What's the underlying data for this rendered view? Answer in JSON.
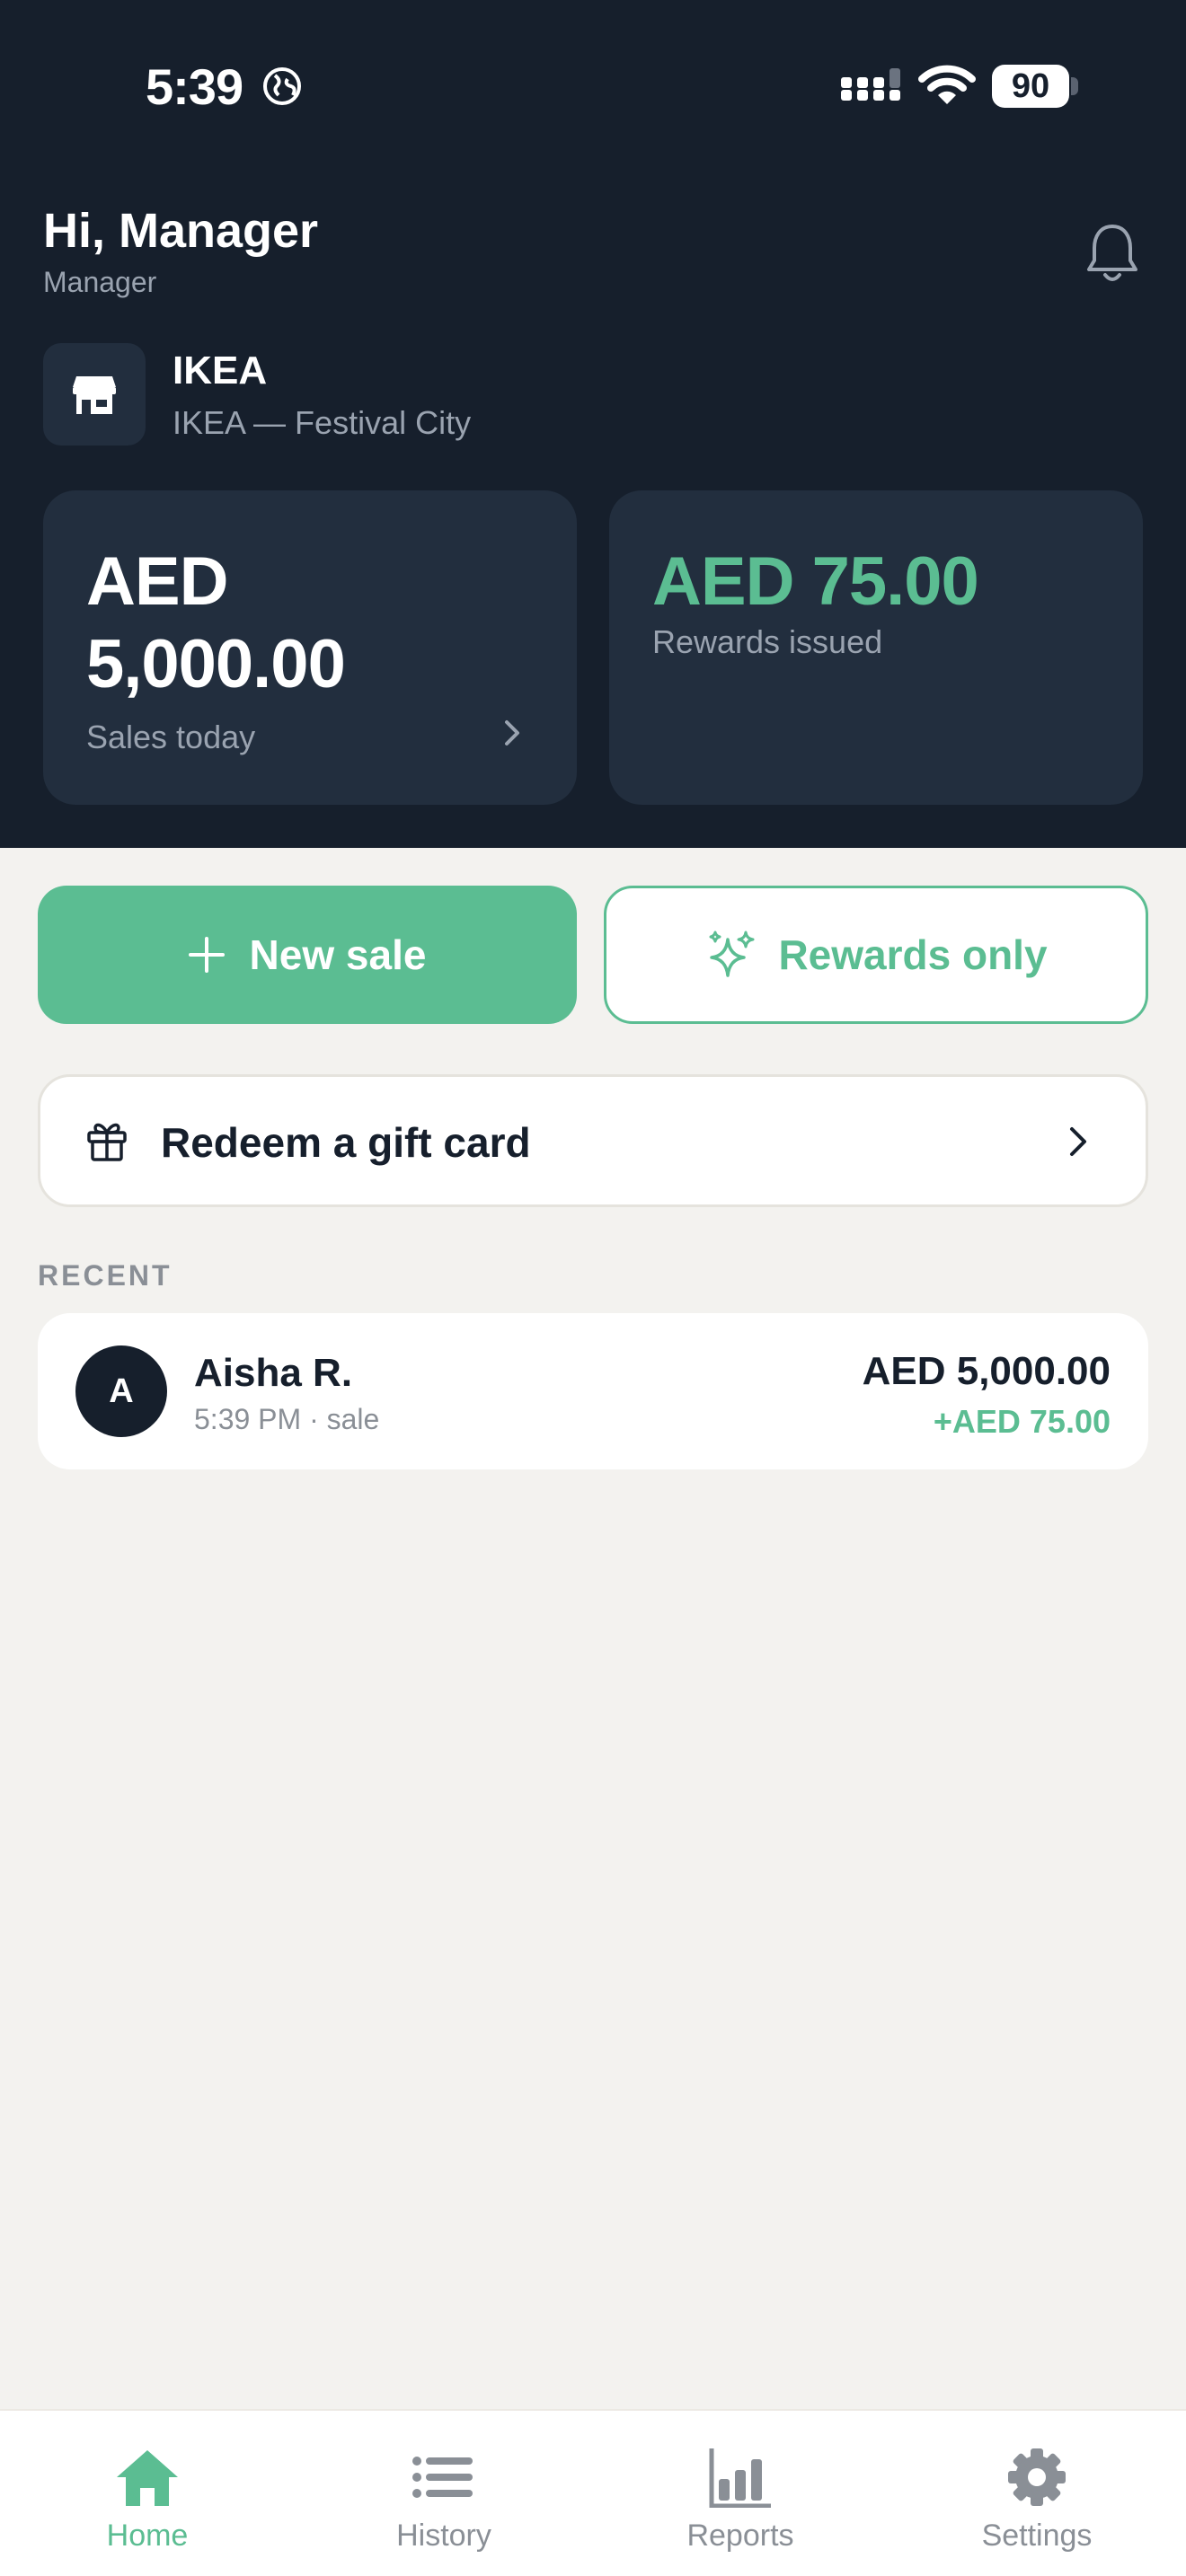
{
  "status_bar": {
    "time": "5:39",
    "battery": "90"
  },
  "header": {
    "greeting": "Hi, Manager",
    "role": "Manager",
    "store": {
      "name": "IKEA",
      "location": "IKEA — Festival City"
    }
  },
  "stats": {
    "sales": {
      "amount_line1": "AED",
      "amount_line2": "5,000.00",
      "label": "Sales today"
    },
    "rewards": {
      "amount": "AED 75.00",
      "label": "Rewards issued"
    }
  },
  "actions": {
    "new_sale": "New sale",
    "rewards_only": "Rewards only",
    "redeem_gift_card": "Redeem a gift card"
  },
  "recent": {
    "title": "RECENT",
    "items": [
      {
        "initial": "A",
        "name": "Aisha R.",
        "meta": "5:39 PM · sale",
        "amount": "AED 5,000.00",
        "reward": "+AED 75.00"
      }
    ]
  },
  "tabs": [
    {
      "label": "Home",
      "icon": "home-icon",
      "active": true
    },
    {
      "label": "History",
      "icon": "list-icon",
      "active": false
    },
    {
      "label": "Reports",
      "icon": "bar-chart-icon",
      "active": false
    },
    {
      "label": "Settings",
      "icon": "gear-icon",
      "active": false
    }
  ],
  "colors": {
    "header_bg": "#161f2c",
    "card_bg": "#222e3e",
    "accent": "#5bbd92",
    "page_bg": "#f3f2ef",
    "muted": "#8a8f96"
  }
}
